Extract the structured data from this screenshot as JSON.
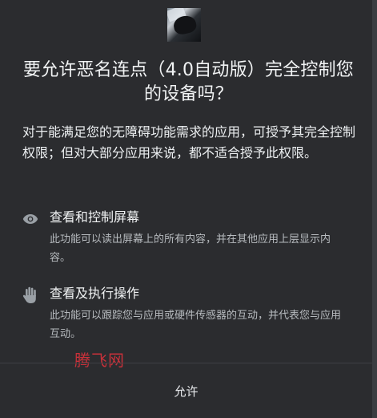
{
  "dialog": {
    "title": "要允许恶名连点（4.0自动版）完全控制您的设备吗？",
    "description": "对于能满足您的无障碍功能需求的应用，可授予其完全控制权限；但对大部分应用来说，都不适合授予此权限。",
    "permissions": [
      {
        "icon": "eye-icon",
        "title": "查看和控制屏幕",
        "description": "此功能可以读出屏幕上的所有内容，并在其他应用上层显示内容。"
      },
      {
        "icon": "hand-icon",
        "title": "查看及执行操作",
        "description": "此功能可以跟踪您与应用或硬件传感器的互动，并代表您与应用互动。"
      }
    ],
    "allow_label": "允许"
  },
  "watermark": {
    "text": "腾飞网",
    "color": "#c8313a"
  },
  "colors": {
    "background": "#2b2c2f",
    "text_primary": "#f1f3f4",
    "text_secondary": "#b7bbbf"
  }
}
